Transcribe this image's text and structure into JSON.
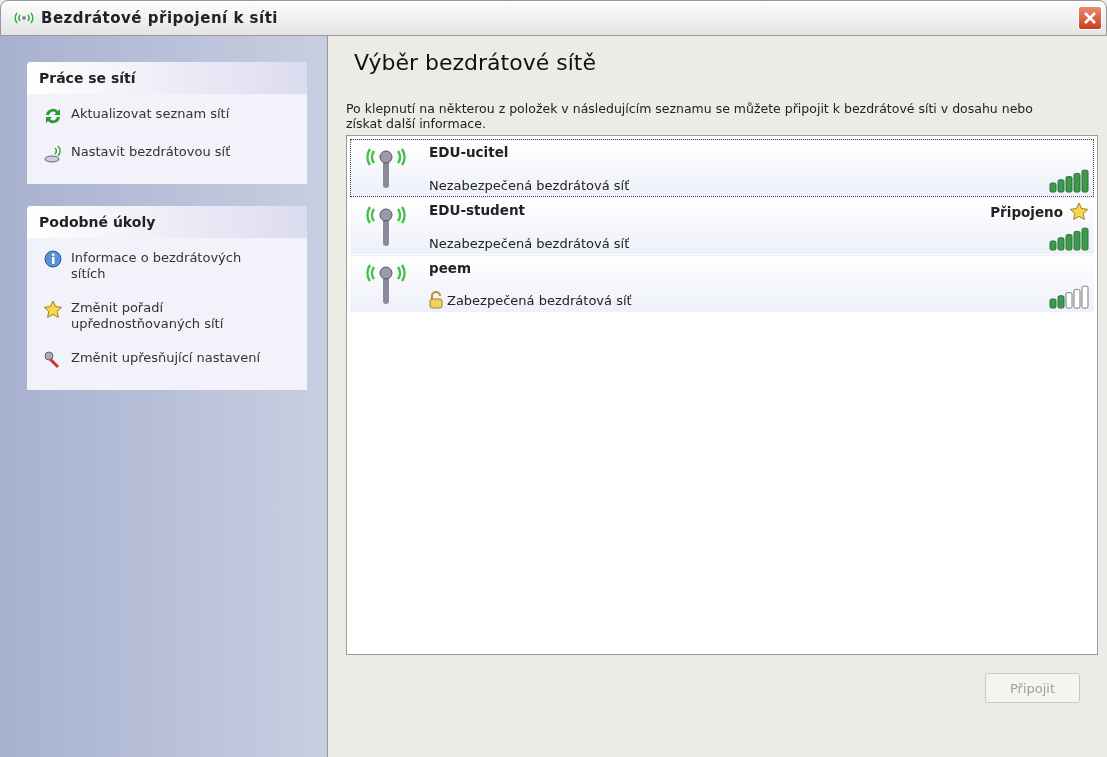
{
  "window": {
    "title": "Bezdrátové připojení k síti"
  },
  "sidebar": {
    "panels": [
      {
        "title": "Práce se sítí",
        "items": [
          {
            "label": "Aktualizovat seznam sítí",
            "kind": "refresh"
          },
          {
            "label": "Nastavit bezdrátovou síť",
            "kind": "setup"
          }
        ]
      },
      {
        "title": "Podobné úkoly",
        "items": [
          {
            "label": "Informace o bezdrátových sítích",
            "kind": "info"
          },
          {
            "label": "Změnit pořadí upřednostňovaných sítí",
            "kind": "star"
          },
          {
            "label": "Změnit upřesňující nastavení",
            "kind": "tools"
          }
        ]
      }
    ]
  },
  "main": {
    "title": "Výběr bezdrátové sítě",
    "description": "Po klepnutí na některou z položek v následujícím seznamu se můžete připojit k bezdrátové síti v dosahu nebo získat další informace.",
    "networks": [
      {
        "name": "EDU-ucitel",
        "security": "Nezabezpečená bezdrátová síť",
        "secured": false,
        "weak_signal": false,
        "selected": true
      },
      {
        "name": "EDU-student",
        "security": "Nezabezpečená bezdrátová síť",
        "secured": false,
        "weak_signal": false,
        "selected": false,
        "status": "Připojeno"
      },
      {
        "name": "peem",
        "security": "Zabezpečená bezdrátová síť",
        "secured": true,
        "weak_signal": true,
        "selected": false
      }
    ]
  },
  "buttons": [
    {
      "label": "Připojit",
      "disabled": true
    }
  ]
}
